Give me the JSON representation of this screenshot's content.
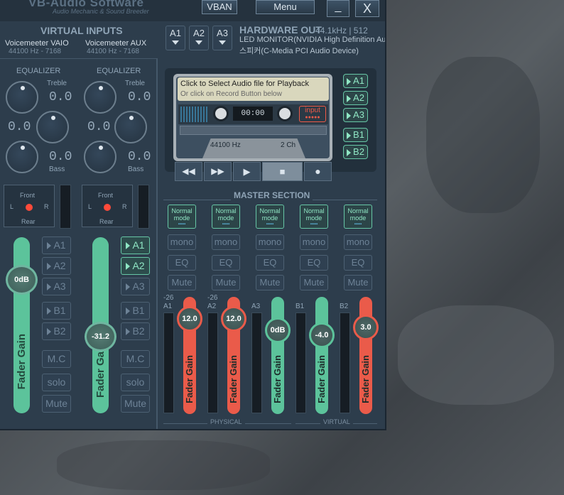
{
  "app": {
    "logo_main": "VB-Audio Software",
    "logo_sub": "Audio Mechanic & Sound Breeder",
    "vban_label": "VBAN",
    "menu_label": "Menu",
    "minimize_glyph": "_",
    "close_glyph": "X"
  },
  "virtual_inputs": {
    "title": "VIRTUAL INPUTS",
    "strips": [
      {
        "name": "Voicemeeter VAIO",
        "rate": "44100 Hz - 7168",
        "eq_label": "EQUALIZER",
        "treble_label": "Treble",
        "treble": "0.0",
        "mid": "0.0",
        "bass": "0.0",
        "bass_label": "Bass",
        "pan_front": "Front",
        "pan_rear": "Rear",
        "pan_l": "L",
        "pan_r": "R",
        "buses": [
          "A1",
          "A2",
          "A3",
          "B1",
          "B2"
        ],
        "active_buses": [],
        "mc": "M.C",
        "solo": "solo",
        "mute": "Mute",
        "fader_label": "Fader Gain",
        "gain": "0dB",
        "fader_level": 0.82
      },
      {
        "name": "Voicemeeter AUX",
        "rate": "44100 Hz - 7168",
        "eq_label": "EQUALIZER",
        "treble_label": "Treble",
        "treble": "0.0",
        "mid": "0.0",
        "bass": "0.0",
        "bass_label": "Bass",
        "pan_front": "Front",
        "pan_rear": "Rear",
        "pan_l": "L",
        "pan_r": "R",
        "buses": [
          "A1",
          "A2",
          "A3",
          "B1",
          "B2"
        ],
        "active_buses": [
          "A1",
          "A2"
        ],
        "mc": "M.C",
        "solo": "solo",
        "mute": "Mute",
        "fader_label": "Fader Ga",
        "gain": "-31.2",
        "fader_level": 0.45
      }
    ]
  },
  "hardware_out": {
    "selectors": [
      "A1",
      "A2",
      "A3"
    ],
    "title": "HARDWARE OUT",
    "rate": "44.1kHz | 512",
    "device1": "LED MONITOR(NVIDIA High Definition Auc",
    "device2": "스피커(C-Media PCI Audio Device)"
  },
  "player": {
    "line1": "Click to Select Audio file for Playback",
    "line2": "Or click on Record Button below",
    "time": "00:00",
    "input_label": "input",
    "hz": "44100 Hz",
    "ch": "2 Ch",
    "side_buses": [
      "A1",
      "A2",
      "A3",
      "B1",
      "B2"
    ]
  },
  "master": {
    "title": "MASTER SECTION",
    "mode": "Normal mode",
    "mono": "mono",
    "eq": "EQ",
    "mute": "Mute",
    "fader_label": "Fader Gain",
    "physical": "PHYSICAL",
    "virtual": "VIRTUAL",
    "strips": [
      {
        "bus": "A1",
        "db_mark": "-26",
        "gain": "12.0",
        "color": "#ea5b4a",
        "level": 0.98
      },
      {
        "bus": "A2",
        "db_mark": "-26",
        "gain": "12.0",
        "color": "#ea5b4a",
        "level": 0.98
      },
      {
        "bus": "A3",
        "db_mark": "",
        "gain": "0dB",
        "color": "#5cc39b",
        "level": 0.86
      },
      {
        "bus": "B1",
        "db_mark": "",
        "gain": "-4.0",
        "color": "#5cc39b",
        "level": 0.81
      },
      {
        "bus": "B2",
        "db_mark": "",
        "gain": "3.0",
        "color": "#ea5b4a",
        "level": 0.89
      }
    ]
  }
}
